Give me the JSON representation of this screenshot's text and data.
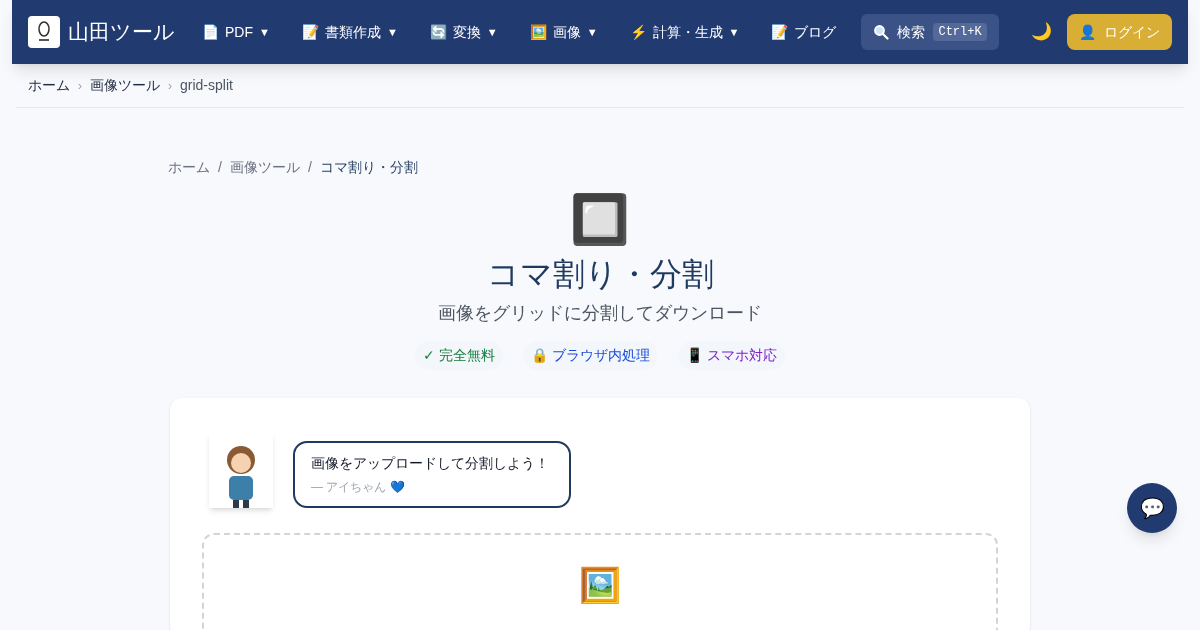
{
  "header": {
    "brand": "山田ツール",
    "nav": [
      {
        "icon": "📄",
        "label": "PDF",
        "caret": "▼"
      },
      {
        "icon": "📝",
        "label": "書類作成",
        "caret": "▼"
      },
      {
        "icon": "🔄",
        "label": "変換",
        "caret": "▼"
      },
      {
        "icon": "🖼️",
        "label": "画像",
        "caret": "▼"
      },
      {
        "icon": "⚡",
        "label": "計算・生成",
        "caret": "▼"
      },
      {
        "icon": "📝",
        "label": "ブログ"
      }
    ],
    "search": {
      "label": "検索",
      "shortcut": "Ctrl+K"
    },
    "theme_toggle": "🌙",
    "login": {
      "icon": "👤",
      "label": "ログイン"
    }
  },
  "top_breadcrumb": {
    "separator": "›",
    "items": [
      "ホーム",
      "画像ツール",
      "grid-split"
    ]
  },
  "breadcrumb": {
    "separator": "/",
    "items": [
      "ホーム",
      "画像ツール",
      "コマ割り・分割"
    ]
  },
  "tool": {
    "icon": "🔲",
    "title": "コマ割り・分割",
    "subtitle": "画像をグリッドに分割してダウンロード",
    "badges": [
      {
        "text": "✓ 完全無料",
        "color": "#15803d"
      },
      {
        "text": "🔒 ブラウザ内処理",
        "color": "#1d4ed8"
      },
      {
        "text": "📱 スマホ対応",
        "color": "#7e22ce"
      }
    ]
  },
  "mascot": {
    "message": "画像をアップロードして分割しよう！",
    "signature": "— アイちゃん 💙"
  },
  "dropzone": {
    "icon": "🖼️"
  },
  "chat_button": "💬"
}
